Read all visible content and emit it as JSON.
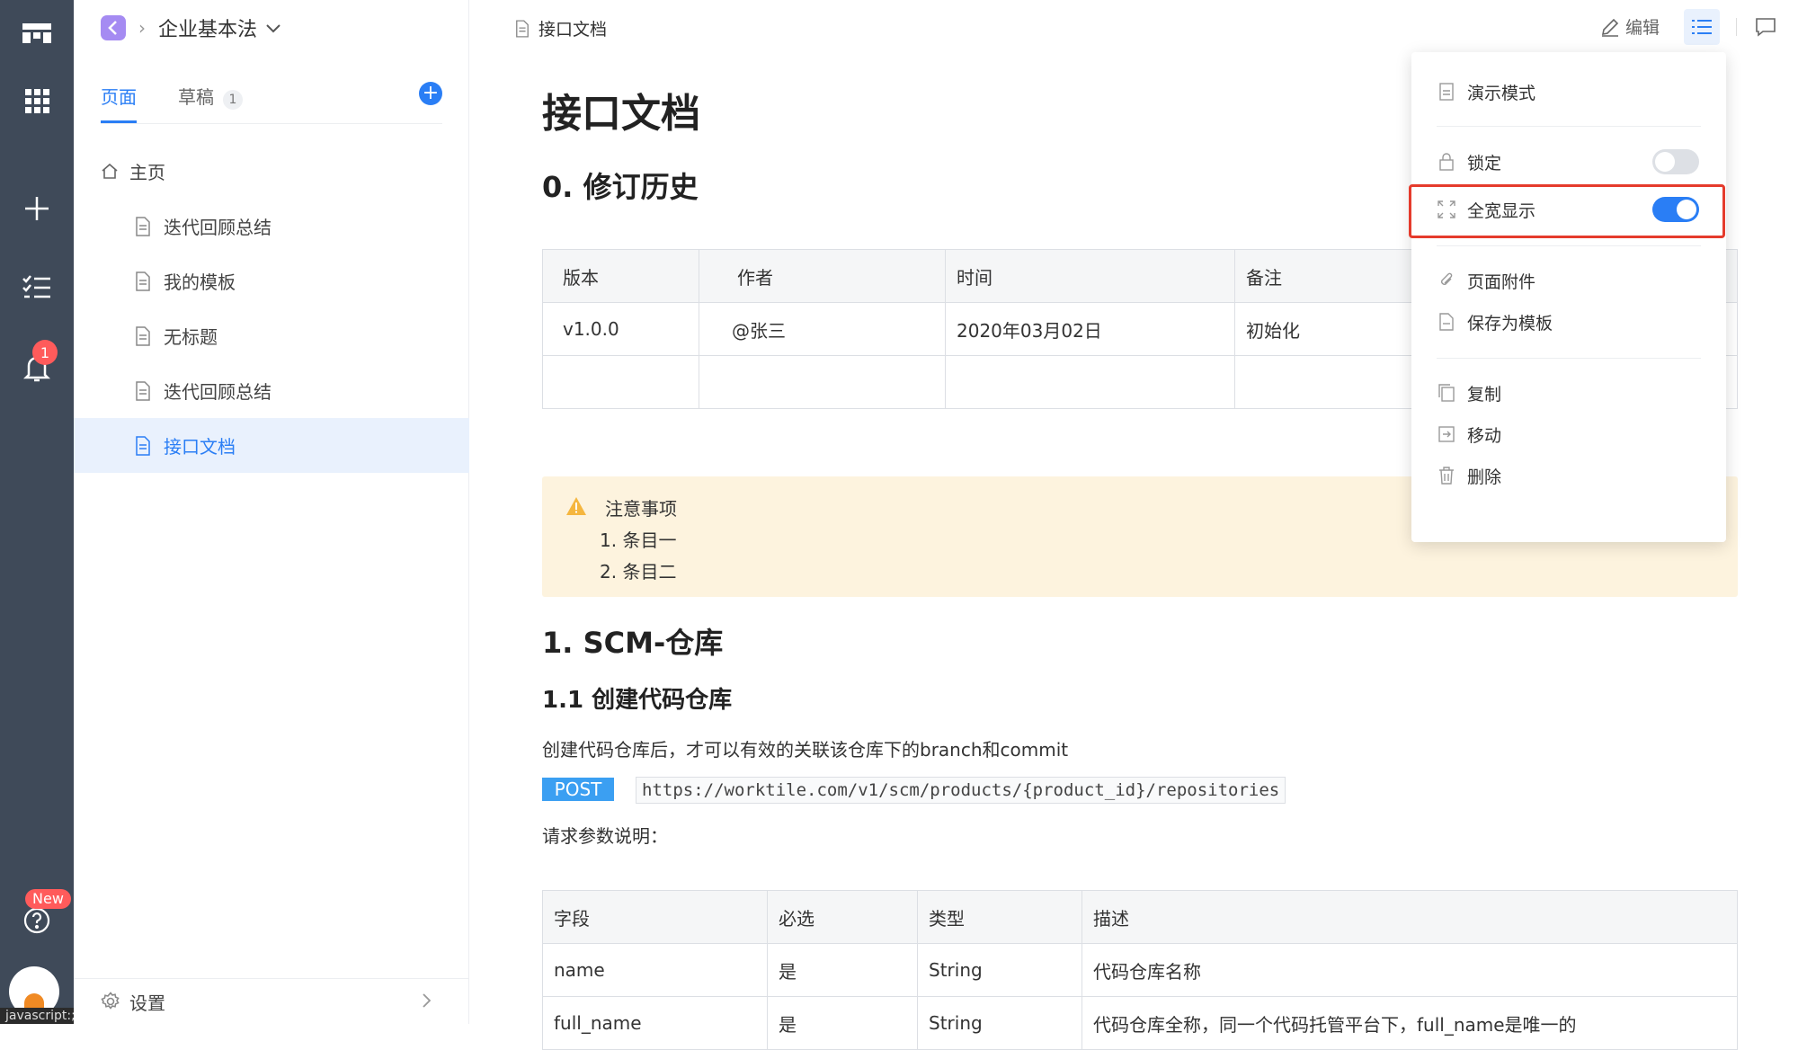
{
  "rail": {
    "icons": [
      "logo-icon",
      "apps-grid-icon",
      "plus-icon",
      "tasks-icon",
      "bell-icon",
      "help-icon"
    ],
    "notification_count": "1",
    "new_label": "New",
    "status_text": "javascript:;"
  },
  "sidebar": {
    "space_title": "企业基本法",
    "tabs": [
      {
        "label": "页面",
        "active": true
      },
      {
        "label": "草稿",
        "count": "1"
      }
    ],
    "home_label": "主页",
    "pages": [
      {
        "label": "迭代回顾总结"
      },
      {
        "label": "我的模板"
      },
      {
        "label": "无标题"
      },
      {
        "label": "迭代回顾总结"
      },
      {
        "label": "接口文档",
        "selected": true
      }
    ],
    "settings_label": "设置"
  },
  "topbar": {
    "breadcrumb": "接口文档",
    "edit_label": "编辑"
  },
  "doc": {
    "title": "接口文档",
    "section0": "0. 修订历史",
    "history_table": {
      "headers": [
        "版本",
        "作者",
        "时间",
        "备注"
      ],
      "rows": [
        [
          "v1.0.0",
          "@张三",
          "2020年03月02日",
          "初始化"
        ],
        [
          "",
          "",
          "",
          ""
        ]
      ]
    },
    "notice": {
      "title": "注意事项",
      "items": [
        "1. 条目一",
        "2. 条目二"
      ]
    },
    "section1": "1. SCM-仓库",
    "section1_1": "1.1 创建代码仓库",
    "desc": "创建代码仓库后，才可以有效的关联该仓库下的branch和commit",
    "method": "POST",
    "url": "https://worktile.com/v1/scm/products/{product_id}/repositories",
    "params_label": "请求参数说明：",
    "params_table": {
      "headers": [
        "字段",
        "必选",
        "类型",
        "描述"
      ],
      "rows": [
        [
          "name",
          "是",
          "String",
          "代码仓库名称"
        ],
        [
          "full_name",
          "是",
          "String",
          "代码仓库全称，同一个代码托管平台下，full_name是唯一的"
        ]
      ]
    }
  },
  "menu": {
    "items": [
      {
        "label": "演示模式",
        "icon": "presentation-icon"
      },
      {
        "label": "锁定",
        "icon": "lock-icon",
        "toggle": "off"
      },
      {
        "label": "全宽显示",
        "icon": "expand-icon",
        "toggle": "on"
      },
      {
        "label": "页面附件",
        "icon": "paperclip-icon"
      },
      {
        "label": "保存为模板",
        "icon": "template-icon"
      },
      {
        "label": "复制",
        "icon": "copy-icon"
      },
      {
        "label": "移动",
        "icon": "move-icon"
      },
      {
        "label": "删除",
        "icon": "trash-icon"
      }
    ]
  },
  "colors": {
    "rail_bg": "#3f4a59",
    "accent": "#2a7ef5",
    "selected_bg": "#e9f1fd",
    "notice_bg": "#fdf3de",
    "highlight": "#e53b2c",
    "badge": "#ff5b5b"
  }
}
